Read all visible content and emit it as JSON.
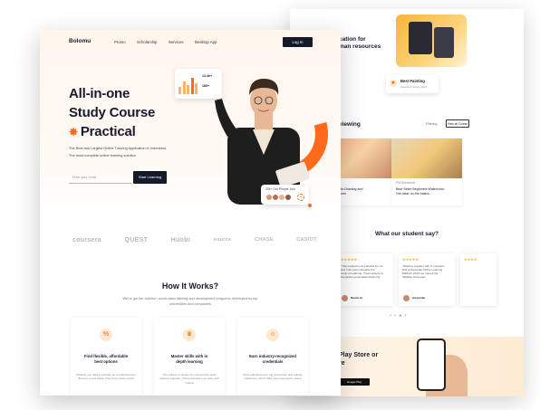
{
  "back_page": {
    "heading": "cation for\nman resources",
    "subtext": "",
    "award": {
      "title": "Best Painting",
      "subtitle": "Awarded ratings 2021"
    },
    "section_title": "viewing",
    "filter_label": "Filtering",
    "view_all": "View all Course",
    "cards": [
      {
        "tag": "",
        "title": "s of Realistic Drawing and\nshion Textures",
        "meta": ""
      },
      {
        "tag": "Phil Simmonds",
        "title": "Best Seller Beginners Watercolor:\nGet clear on the basics",
        "meta": ""
      }
    ],
    "testimonial_title": "What our student say?",
    "testimonial_sub": "",
    "reviews": [
      {
        "stars": "★★★★★",
        "text": "\"This method is very flexible for me\nand I can even schedule the\nsetup of Learning. I have access to\ninteractive personalised learning\"",
        "name": "Nicole Jo"
      },
      {
        "stars": "★★★★★",
        "text": "\"Working together with IT members\nbuilt a Corporate Online Learning\nPlatform which we named the\nSkillship Corporate\"",
        "name": "Alexander"
      },
      {
        "stars": "★★★★",
        "text": "",
        "name": ""
      }
    ],
    "app": {
      "title": "Play Store or\nre",
      "sub": "",
      "google_play": "Google Play"
    }
  },
  "front_page": {
    "logo": "Bolomu",
    "nav": [
      "Promo",
      "Scholarship",
      "Services",
      "Desktop App"
    ],
    "login": "Log In",
    "hero_title_1": "All-in-one",
    "hero_title_2": "Study Course",
    "hero_title_3": "Practical",
    "hero_desc_1": "The Best and Largest Online Tutoring Application in Indonesia.",
    "hero_desc_2": "The most complete online learning solution",
    "email_placeholder": "Enter your email",
    "start_button": "Start Learning",
    "stats": {
      "v1": "12.4k+",
      "v2": "180+"
    },
    "people_label": "20k+ Our People Join",
    "brands": [
      "coursera",
      "QUEST",
      "Huobi",
      "source",
      "CHASE",
      "CASIOT"
    ],
    "how_title": "How It Works?",
    "how_sub": "We've got the solution, world-class training and development programs developed by top universities and companies",
    "features": [
      {
        "icon": "tag-icon",
        "title": "Find flexible, affordable\nbest options",
        "desc": "Whether you want to develop as a professional or discover a new hobby, there's an online course"
      },
      {
        "icon": "crown-icon",
        "title": "Master skills with in\ndepth learning",
        "desc": "Join millions of people from around the world learning together. Online learning is as easy, and natural"
      },
      {
        "icon": "certificate-icon",
        "title": "Earn industry-recognized\ncredentials",
        "desc": "Meet educators from top universities and cultural institutions, who'll share their experience videos"
      }
    ]
  },
  "colors": {
    "accent": "#ff6a1a",
    "dark": "#151a2b"
  }
}
